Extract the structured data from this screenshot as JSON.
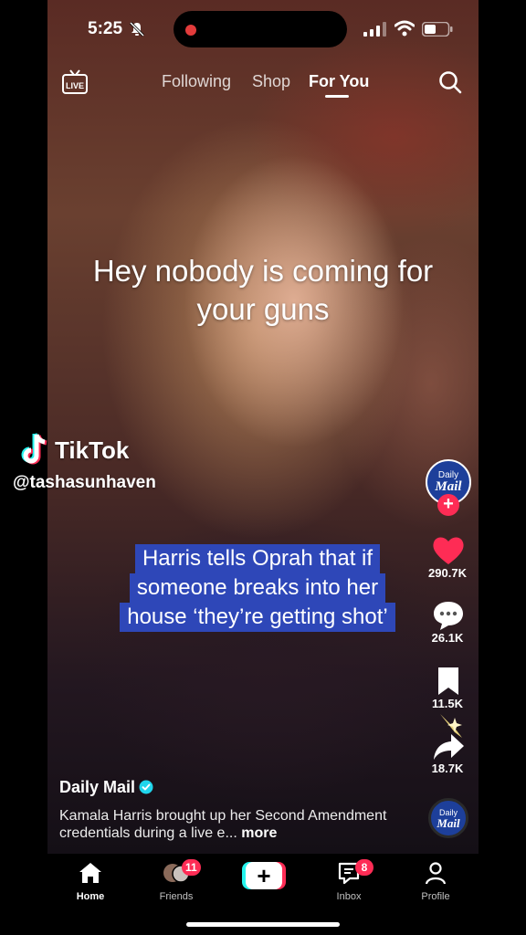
{
  "status_bar": {
    "time": "5:25"
  },
  "top_nav": {
    "tabs": [
      {
        "label": "Following"
      },
      {
        "label": "Shop"
      },
      {
        "label": "For You",
        "active": true
      }
    ],
    "live_label": "LIVE"
  },
  "video": {
    "caption": "Hey nobody is coming for your guns",
    "caption_lines": [
      "Hey nobody is coming for",
      "your guns"
    ],
    "watermark_brand": "TikTok",
    "watermark_handle": "@tashasunhaven",
    "subtitle_lines": [
      "Harris tells Oprah that if",
      "someone breaks into her",
      "house ‘they’re getting shot’"
    ]
  },
  "creator_logo": {
    "line1": "Daily",
    "line2": "Mail"
  },
  "actions": {
    "likes": "290.7K",
    "comments": "26.1K",
    "saves": "11.5K",
    "shares": "18.7K"
  },
  "post": {
    "author": "Daily Mail",
    "description": "Kamala Harris brought up her Second Amendment credentials during a live e...",
    "more": "more"
  },
  "tabbar": {
    "home": "Home",
    "friends": "Friends",
    "friends_badge": "11",
    "inbox": "Inbox",
    "inbox_badge": "8",
    "profile": "Profile"
  },
  "colors": {
    "accent_red": "#fe2c55",
    "accent_cyan": "#25f4ee",
    "subtitle_bg": "#2e47b8",
    "verified": "#20d5ec"
  }
}
